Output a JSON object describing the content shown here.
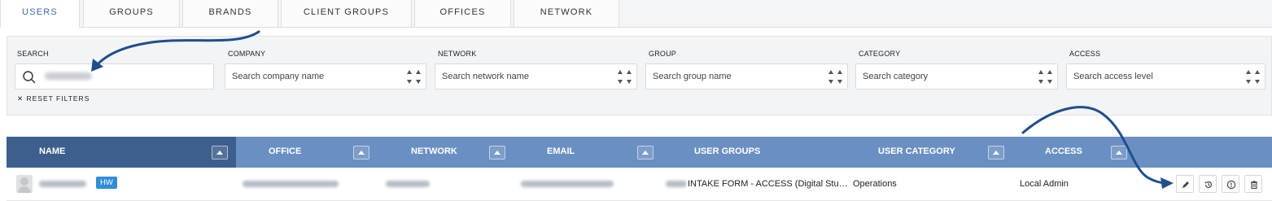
{
  "tabs": [
    {
      "label": "USERS",
      "active": true
    },
    {
      "label": "GROUPS",
      "active": false
    },
    {
      "label": "BRANDS",
      "active": false
    },
    {
      "label": "CLIENT GROUPS",
      "active": false
    },
    {
      "label": "OFFICES",
      "active": false
    },
    {
      "label": "NETWORK",
      "active": false
    }
  ],
  "filters": {
    "search": {
      "label": "SEARCH",
      "icon": "search-icon"
    },
    "company": {
      "label": "COMPANY",
      "placeholder": "Search company name"
    },
    "network": {
      "label": "NETWORK",
      "placeholder": "Search network name"
    },
    "group": {
      "label": "GROUP",
      "placeholder": "Search group name"
    },
    "category": {
      "label": "CATEGORY",
      "placeholder": "Search category"
    },
    "access": {
      "label": "ACCESS",
      "placeholder": "Search access level"
    },
    "reset_label": "RESET FILTERS"
  },
  "table": {
    "columns": [
      "NAME",
      "OFFICE",
      "NETWORK",
      "EMAIL",
      "USER GROUPS",
      "USER CATEGORY",
      "ACCESS"
    ],
    "rows": [
      {
        "badge": "HW",
        "user_groups": "INTAKE FORM - ACCESS (Digital Stu…",
        "user_category": "Operations",
        "access": "Local Admin"
      }
    ],
    "actions": [
      "edit-icon",
      "history-icon",
      "info-icon",
      "delete-icon"
    ]
  },
  "colors": {
    "accent": "#3c6aa8",
    "header_bg": "#6a90c3",
    "header_name_bg": "#3d5f8e",
    "badge_bg": "#2f8ed6",
    "annotation_arrow": "#1f4e8c"
  }
}
